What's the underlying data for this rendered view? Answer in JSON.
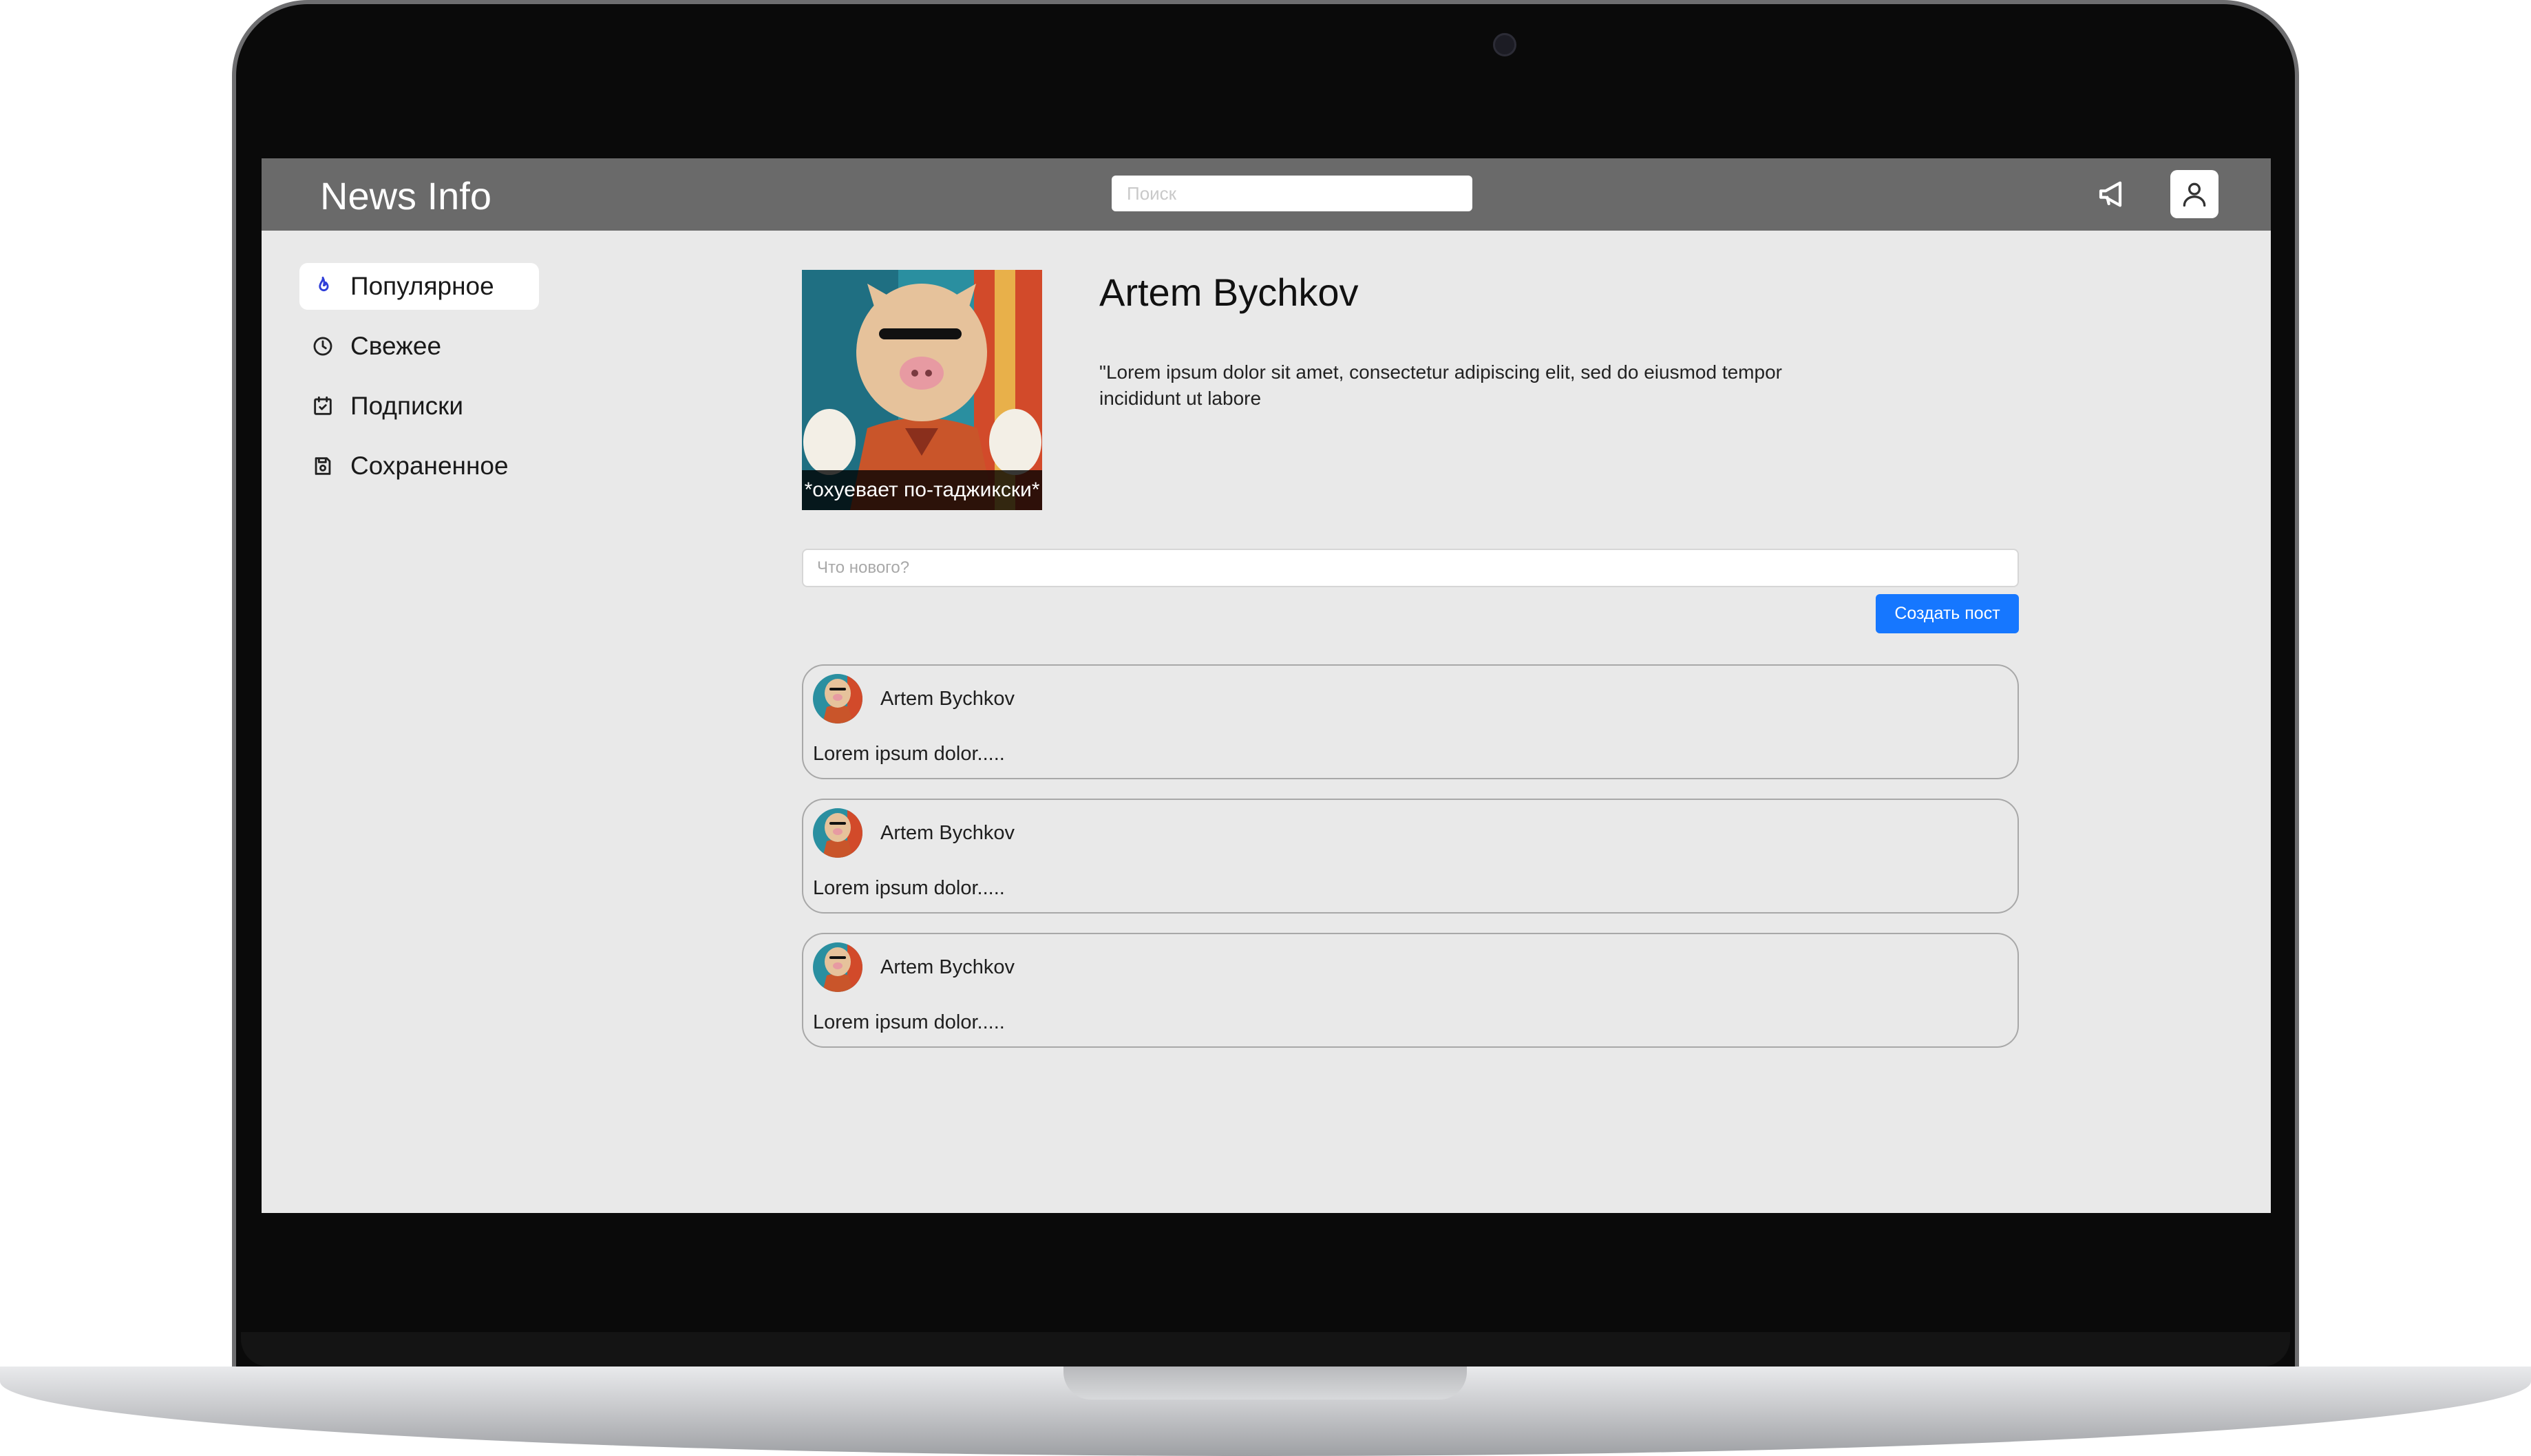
{
  "app": {
    "title": "News Info"
  },
  "search": {
    "placeholder": "Поиск"
  },
  "sidebar": {
    "items": [
      {
        "label": "Популярное",
        "icon": "flame-icon",
        "active": true
      },
      {
        "label": "Свежее",
        "icon": "clock-icon",
        "active": false
      },
      {
        "label": "Подписки",
        "icon": "calendar-check-icon",
        "active": false
      },
      {
        "label": "Сохраненное",
        "icon": "save-icon",
        "active": false
      }
    ]
  },
  "profile": {
    "name": "Artem Bychkov",
    "bio": "\"Lorem ipsum dolor sit amet, consectetur adipiscing elit, sed do eiusmod tempor incididunt ut labore",
    "avatar_caption": "*охуевает по-таджикски*"
  },
  "composer": {
    "placeholder": "Что нового?",
    "button_label": "Создать пост"
  },
  "posts": [
    {
      "author": "Artem Bychkov",
      "text": "Lorem ipsum dolor....."
    },
    {
      "author": "Artem Bychkov",
      "text": "Lorem ipsum dolor....."
    },
    {
      "author": "Artem Bychkov",
      "text": "Lorem ipsum dolor....."
    }
  ],
  "colors": {
    "topbar": "#6a6a6a",
    "background": "#e9e9e9",
    "accent": "#1677ff"
  }
}
